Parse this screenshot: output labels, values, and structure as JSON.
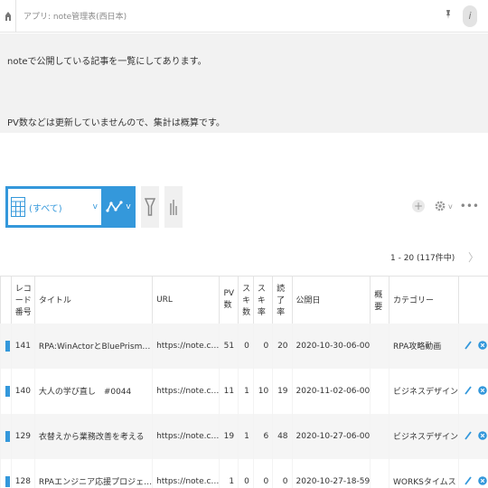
{
  "header": {
    "breadcrumb": "アプリ: note管理表(西日本)"
  },
  "description": {
    "line1": "noteで公開している記事を一覧にしてあります。",
    "line2": "PV数などは更新していませんので、集計は概算です。"
  },
  "toolbar": {
    "view_label": "(すべて)",
    "chevron": "v"
  },
  "pager": {
    "text": "1 - 20 (117件中)",
    "next": "〉"
  },
  "table": {
    "columns": [
      "レコード番号",
      "タイトル",
      "URL",
      "PV数",
      "スキ数",
      "スキ率",
      "読了率",
      "公開日",
      "概要",
      "カテゴリー"
    ],
    "rows": [
      [
        "141",
        "RPA:WinActorとBluePrism…",
        "https://note.c…",
        "51",
        "0",
        "0",
        "20",
        "2020-10-30-06-00",
        "",
        "RPA攻略動画"
      ],
      [
        "140",
        "大人の学び直し　#0044",
        "https://note.c…",
        "11",
        "1",
        "10",
        "19",
        "2020-11-02-06-00",
        "",
        "ビジネスデザイン"
      ],
      [
        "129",
        "衣替えから業務改善を考える",
        "https://note.c…",
        "19",
        "1",
        "6",
        "48",
        "2020-10-27-06-00",
        "",
        "ビジネスデザイン"
      ],
      [
        "128",
        "RPAエンジニア応援プロジェ…",
        "https://note.c…",
        "1",
        "0",
        "0",
        "0",
        "2020-10-27-18-59",
        "",
        "WORKSタイムス"
      ]
    ]
  },
  "colors": {
    "accent": "#3498db",
    "row_alt": "#f5f5f5",
    "panel": "#f2f2f2"
  },
  "icons": [
    "home-icon",
    "pin-icon",
    "info-icon",
    "calendar-icon",
    "graph-icon",
    "filter-icon",
    "bar-chart-icon",
    "add-icon",
    "gear-icon",
    "more-icon",
    "edit-icon",
    "delete-icon"
  ]
}
